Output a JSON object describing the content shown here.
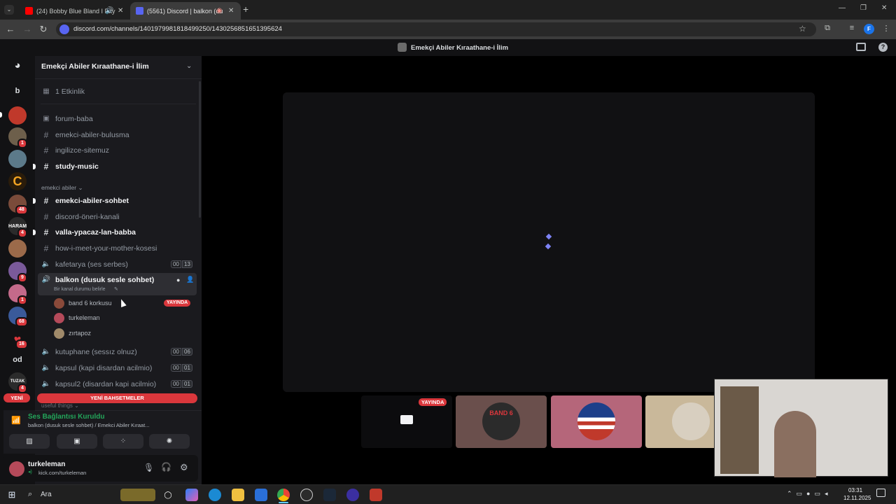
{
  "browser": {
    "tabs": [
      {
        "title": "(24) Bobby Blue Bland I Pity",
        "favicon_color": "#ff0000"
      },
      {
        "title": "(5561) Discord | balkon (du",
        "favicon_color": "#5865f2"
      }
    ],
    "new_tab": "+",
    "url": "discord.com/channels/1401979981818499250/1430256851651395624",
    "window_controls": {
      "minimize": "—",
      "maximize": "❐",
      "close": "✕"
    },
    "profile_initial": "F"
  },
  "discord": {
    "window_title": "Emekçi Abiler Kıraathane-i İlim",
    "server_name": "Emekçi Abiler Kıraathane-i İlim",
    "events": "1 Etkinlik",
    "rail": {
      "badges": [
        "1",
        "48",
        "4",
        "9",
        "1",
        "68",
        "16",
        "4"
      ],
      "letters": [
        "b",
        "od"
      ],
      "new_label": "YENİ"
    },
    "channels_top": [
      {
        "name": "forum-baba",
        "unread": false
      },
      {
        "name": "emekci-abiler-bulusma",
        "unread": false
      },
      {
        "name": "ingilizce-sitemuz",
        "unread": false
      },
      {
        "name": "study-music",
        "unread": true
      }
    ],
    "category": "emekci abiler",
    "channels_cat": [
      {
        "name": "emekci-abiler-sohbet",
        "unread": true
      },
      {
        "name": "discord-öneri-kanali",
        "unread": false
      },
      {
        "name": "valla-ypacaz-lan-babba",
        "unread": true
      },
      {
        "name": "how-i-meet-your-mother-kosesi",
        "unread": false
      }
    ],
    "voice_kafetarya": {
      "name": "kafetarya (ses serbes)",
      "c1": "00",
      "c2": "13"
    },
    "voice_balkon": {
      "name": "balkon (dusuk sesle sohbet)",
      "status": "Bir kanal durumu belirle"
    },
    "voice_users": [
      {
        "name": "band 6 korkusu",
        "live": "YAYINDA"
      },
      {
        "name": "turkeleman"
      },
      {
        "name": "zırtapoz"
      }
    ],
    "voice_others": [
      {
        "name": "kutuphane (sessız olnuz)",
        "c1": "00",
        "c2": "06"
      },
      {
        "name": "kapsul (kapi disardan acilmio)",
        "c1": "00",
        "c2": "01"
      },
      {
        "name": "kapsul2 (disardan kapi acilmio)",
        "c1": "00",
        "c2": "01"
      }
    ],
    "new_mentions": "YENİ BAHSETMELER",
    "next_category": "useful things",
    "voice_connected": {
      "title": "Ses Bağlantısı Kuruldu",
      "subtitle": "balkon (dusuk sesle sohbet) / Emekci Abiler Kıraat..."
    },
    "user": {
      "name": "turkeleman",
      "status": "kick.com/turkeleman"
    },
    "stream": {
      "live_label": "YAYINDA",
      "tile2_text": "BAND 6"
    },
    "colors": {
      "accent": "#5865f2",
      "live": "#da373c",
      "connected": "#23a55a"
    }
  },
  "taskbar": {
    "search": "Ara",
    "time": "03:31",
    "date": "12.11.2025"
  }
}
